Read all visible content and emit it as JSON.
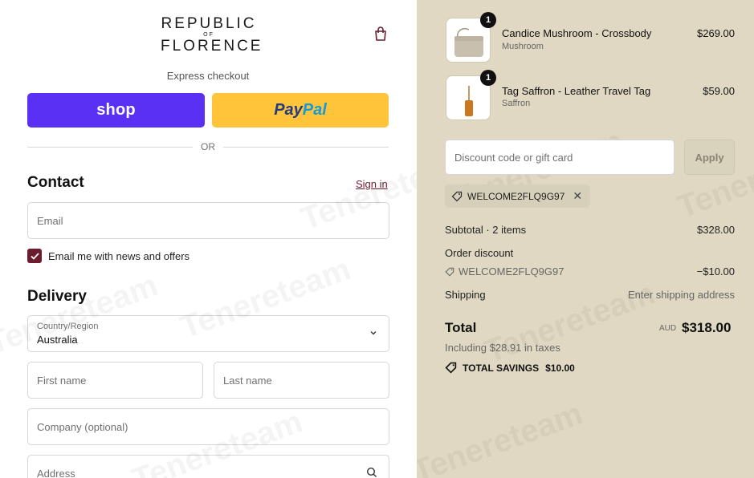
{
  "brand": {
    "line1": "REPUBLIC",
    "line2": "OF",
    "line3": "FLORENCE"
  },
  "express": {
    "label": "Express checkout",
    "shop_label": "shop",
    "paypal_part1": "Pay",
    "paypal_part2": "Pal",
    "or_label": "OR"
  },
  "contact": {
    "heading": "Contact",
    "signin_label": "Sign in",
    "email_placeholder": "Email",
    "newsletter_label": "Email me with news and offers",
    "newsletter_checked": true
  },
  "delivery": {
    "heading": "Delivery",
    "country_label": "Country/Region",
    "country_value": "Australia",
    "first_name_placeholder": "First name",
    "last_name_placeholder": "Last name",
    "company_placeholder": "Company (optional)",
    "address_placeholder": "Address"
  },
  "cart": {
    "items": [
      {
        "name": "Candice Mushroom - Crossbody",
        "variant": "Mushroom",
        "price": "$269.00",
        "qty": "1"
      },
      {
        "name": "Tag Saffron - Leather Travel Tag",
        "variant": "Saffron",
        "price": "$59.00",
        "qty": "1"
      }
    ],
    "discount_placeholder": "Discount code or gift card",
    "apply_label": "Apply",
    "applied_code": "WELCOME2FLQ9G97"
  },
  "summary": {
    "subtotal_label": "Subtotal · 2 items",
    "subtotal_value": "$328.00",
    "order_discount_label": "Order discount",
    "discount_code": "WELCOME2FLQ9G97",
    "discount_value": "−$10.00",
    "shipping_label": "Shipping",
    "shipping_value": "Enter shipping address",
    "total_label": "Total",
    "currency": "AUD",
    "total_value": "$318.00",
    "taxes_note": "Including $28.91 in taxes",
    "savings_label": "TOTAL SAVINGS",
    "savings_value": "$10.00"
  },
  "watermark_text": "Tenereteam",
  "colors": {
    "accent": "#6b1d2f",
    "shop": "#5a31f4",
    "paypal": "#ffc439",
    "summary_bg": "#e0d8c2"
  }
}
